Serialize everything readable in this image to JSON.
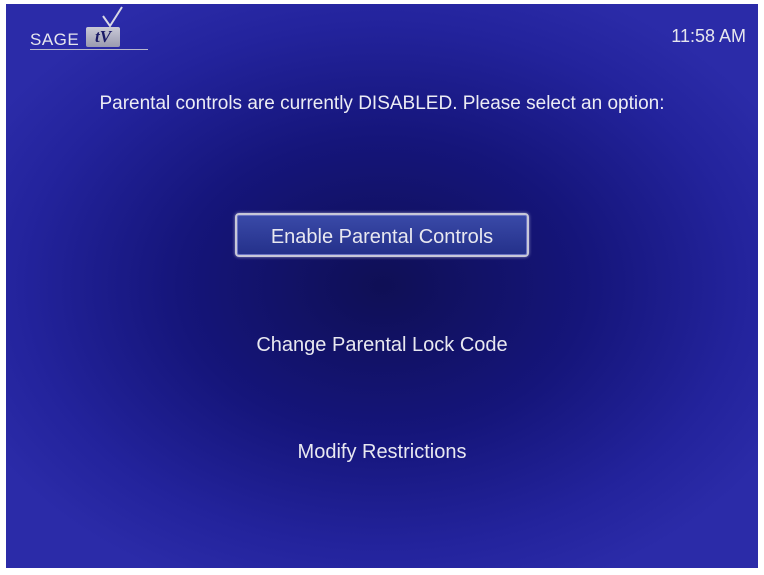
{
  "header": {
    "logo_text": "SAGE",
    "logo_badge": "tV",
    "time": "11:58 AM"
  },
  "message": "Parental controls are currently DISABLED. Please select an option:",
  "menu": {
    "items": [
      {
        "label": "Enable Parental Controls",
        "selected": true
      },
      {
        "label": "Change Parental Lock Code",
        "selected": false
      },
      {
        "label": "Modify Restrictions",
        "selected": false
      }
    ]
  },
  "colors": {
    "background": "#15157a",
    "text": "#ececf4",
    "selection": "#2a3694"
  },
  "icons": [
    "sage-tv-logo"
  ]
}
